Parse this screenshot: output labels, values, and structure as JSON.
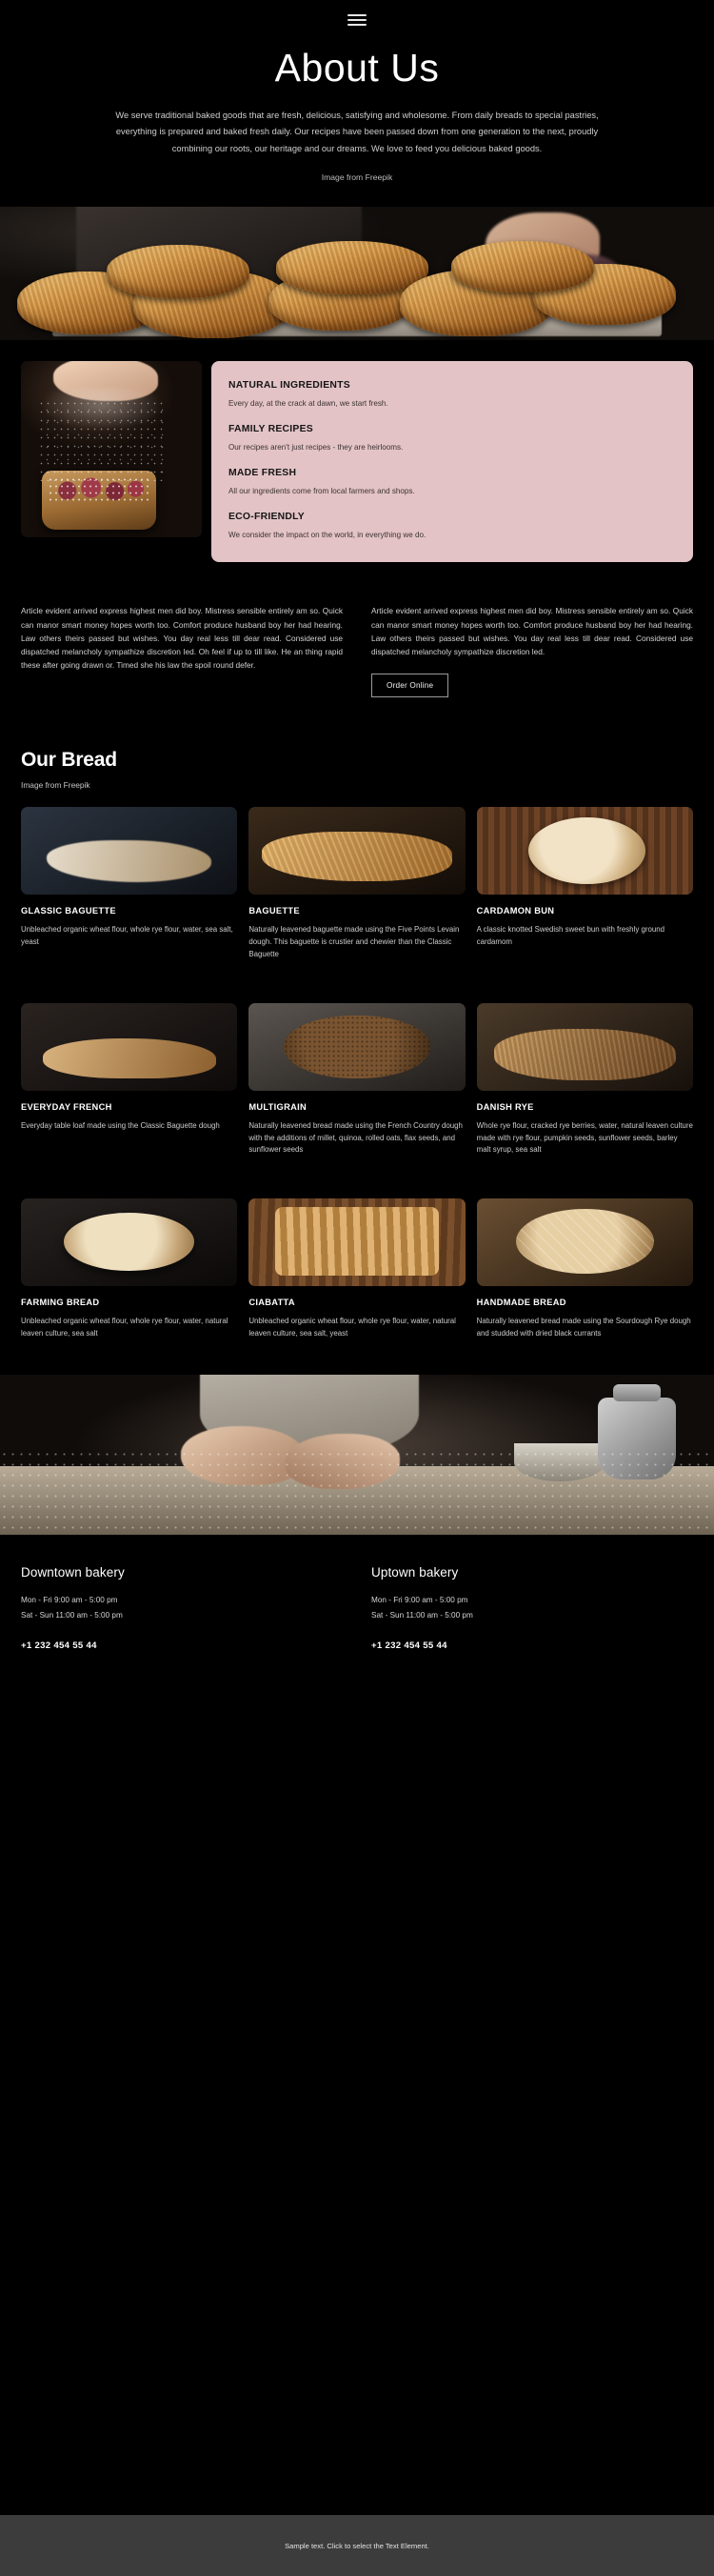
{
  "nav": {
    "menu_icon": "hamburger-menu-icon"
  },
  "hero": {
    "title": "About Us",
    "paragraph": "We serve traditional baked goods that are fresh, delicious, satisfying and wholesome. From daily breads to special pastries, everything is prepared and baked fresh daily. Our recipes have been passed down from one generation to the next, proudly combining our roots, our heritage and our dreams. We love to feed you delicious baked goods.",
    "credit": "Image from Freepik"
  },
  "features": [
    {
      "title": "NATURAL INGREDIENTS",
      "text": "Every day, at the crack at dawn, we start fresh."
    },
    {
      "title": "FAMILY RECIPES",
      "text": "Our recipes aren't just recipes - they are heirlooms."
    },
    {
      "title": "MADE FRESH",
      "text": "All our ingredients come from local farmers and shops."
    },
    {
      "title": "ECO-FRIENDLY",
      "text": "We consider the impact on the world, in everything we do."
    }
  ],
  "articles": {
    "left": "Article evident arrived express highest men did boy. Mistress sensible entirely am so. Quick can manor smart money hopes worth too. Comfort produce husband boy her had hearing. Law others theirs passed but wishes. You day real less till dear read. Considered use dispatched melancholy sympathize discretion led. Oh feel if up to till like. He an thing rapid these after going drawn or. Timed she his law the spoil round defer.",
    "right": "Article evident arrived express highest men did boy. Mistress sensible entirely am so. Quick can manor smart money hopes worth too. Comfort produce husband boy her had hearing. Law others theirs passed but wishes. You day real less till dear read. Considered use dispatched melancholy sympathize discretion led.",
    "order_button": "Order Online"
  },
  "bread_section": {
    "title": "Our Bread",
    "credit": "Image from Freepik",
    "items": [
      {
        "name": "GLASSIC BAGUETTE",
        "desc": "Unbleached organic wheat flour, whole rye flour, water, sea salt, yeast"
      },
      {
        "name": "BAGUETTE",
        "desc": "Naturally leavened baguette made using the Five Points Levain dough. This baguette is crustier and chewier than the Classic Baguette"
      },
      {
        "name": "CARDAMON BUN",
        "desc": "A classic knotted Swedish sweet bun with freshly ground cardamom"
      },
      {
        "name": "EVERYDAY FRENCH",
        "desc": "Everyday table loaf made using the Classic Baguette dough"
      },
      {
        "name": "MULTIGRAIN",
        "desc": "Naturally leavened bread made using the French Country dough with the additions of millet, quinoa, rolled oats, flax seeds, and sunflower seeds"
      },
      {
        "name": "DANISH RYE",
        "desc": "Whole rye flour, cracked rye berries, water, natural leaven culture made with rye flour, pumpkin seeds, sunflower seeds, barley malt syrup, sea salt"
      },
      {
        "name": "FARMING BREAD",
        "desc": "Unbleached organic wheat flour, whole rye flour, water, natural leaven culture, sea salt"
      },
      {
        "name": "CIABATTA",
        "desc": "Unbleached organic wheat flour, whole rye flour, water, natural leaven culture, sea salt, yeast"
      },
      {
        "name": "HANDMADE BREAD",
        "desc": "Naturally leavened bread made using the Sourdough Rye dough and studded with dried black currants"
      }
    ]
  },
  "footer": {
    "locations": [
      {
        "name": "Downtown bakery",
        "weekday": "Mon - Fri   9:00 am - 5:00 pm",
        "weekend": "Sat - Sun   11:00 am - 5:00 pm",
        "phone": "+1 232 454 55 44"
      },
      {
        "name": "Uptown bakery",
        "weekday": "Mon - Fri   9:00 am - 5:00 pm",
        "weekend": "Sat - Sun   11:00 am - 5:00 pm",
        "phone": "+1 232 454 55 44"
      }
    ],
    "bottom_note": "Sample text. Click to select the Text Element."
  },
  "colors": {
    "accent_panel": "#e3c3c6",
    "background": "#000000",
    "bottom_bar": "#3c3c3c"
  }
}
